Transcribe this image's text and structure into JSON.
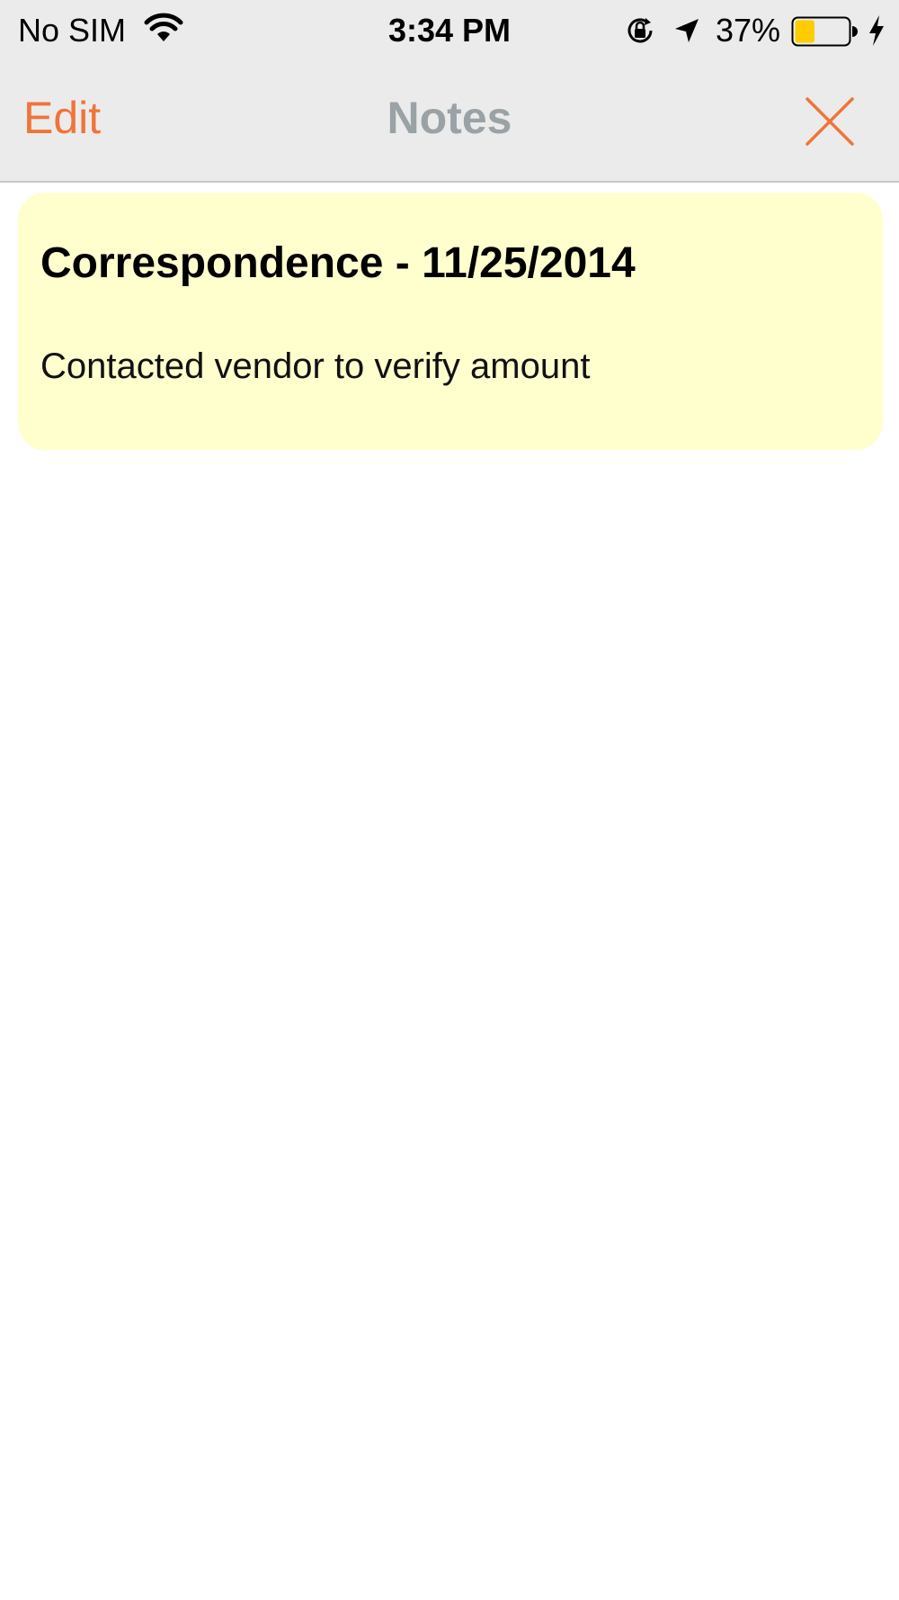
{
  "status_bar": {
    "carrier": "No SIM",
    "time": "3:34 PM",
    "battery_percent": "37%",
    "battery_level": 0.37,
    "battery_color": "#ffcc00",
    "icons": [
      "wifi-icon",
      "orientation-lock-icon",
      "location-icon",
      "battery-icon",
      "charging-icon"
    ]
  },
  "nav_bar": {
    "edit_label": "Edit",
    "title": "Notes",
    "close_icon": "close-icon",
    "accent_color": "#f0743a",
    "title_color": "#9aa2a6"
  },
  "notes": [
    {
      "title": "Correspondence - 11/25/2014",
      "body": "Contacted vendor to verify amount",
      "background": "#ffffce"
    }
  ]
}
